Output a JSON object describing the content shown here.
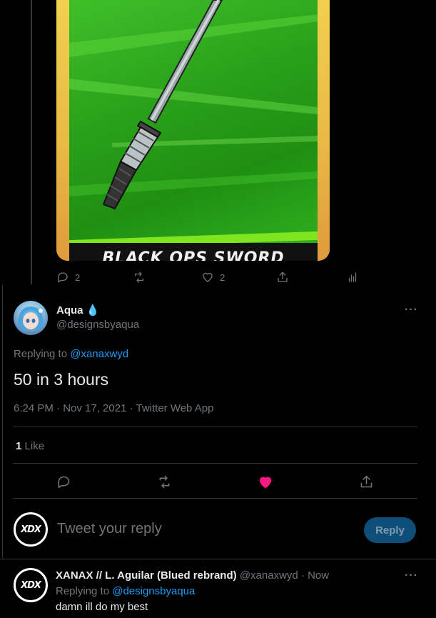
{
  "quoted_media": {
    "banner_text": "BLACK OPS SWORD",
    "actions": {
      "reply_count": "2",
      "like_count": "2"
    }
  },
  "tweet": {
    "author_name": "Aqua",
    "author_emoji": "💧",
    "author_handle": "@designsbyaqua",
    "replying_prefix": "Replying to ",
    "replying_to": "@xanaxwyd",
    "text": "50 in 3 hours",
    "timestamp": "6:24 PM · Nov 17, 2021 · Twitter Web App",
    "likes_count": "1",
    "likes_label": "Like",
    "more_label": "···"
  },
  "composer": {
    "placeholder": "Tweet your reply",
    "reply_button": "Reply",
    "avatar_text": "XDX"
  },
  "reply": {
    "author_name": "XANAX // L. Aguilar (Blued rebrand)",
    "author_handle": "@xanaxwyd",
    "time": "· Now",
    "replying_prefix": "Replying to ",
    "replying_to": "@designsbyaqua",
    "text": "damn ill do my best",
    "avatar_text": "XDX",
    "more_label": "···"
  },
  "colors": {
    "like_active": "#f91880",
    "link": "#1d9bf0",
    "reply_button": "#0f4e78"
  }
}
